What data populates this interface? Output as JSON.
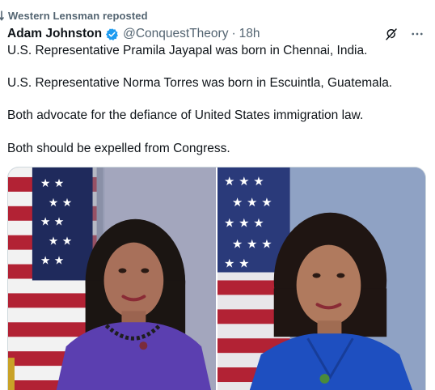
{
  "repost": {
    "label": "Western Lensman reposted",
    "icon": "repost-icon"
  },
  "tweet": {
    "author_name": "Adam Johnston",
    "handle": "@ConquestTheory",
    "separator": "·",
    "time": "18h",
    "verified_icon": "verified-badge-icon",
    "verified_color": "#1d9bf0",
    "lines": [
      "U.S. Representative Pramila Jayapal was born in Chennai, India.",
      "U.S. Representative Norma Torres was born in Escuintla, Guatemala.",
      "Both advocate for the defiance of United States immigration law.",
      "Both should be expelled from Congress."
    ],
    "actions": {
      "grok_icon": "grok-icon",
      "more_icon": "more-icon"
    },
    "media": [
      {
        "icon": "photo-portrait-1"
      },
      {
        "icon": "photo-portrait-2"
      }
    ]
  },
  "colors": {
    "text_primary": "#0f1419",
    "text_secondary": "#536471",
    "border": "#cfd9de"
  }
}
